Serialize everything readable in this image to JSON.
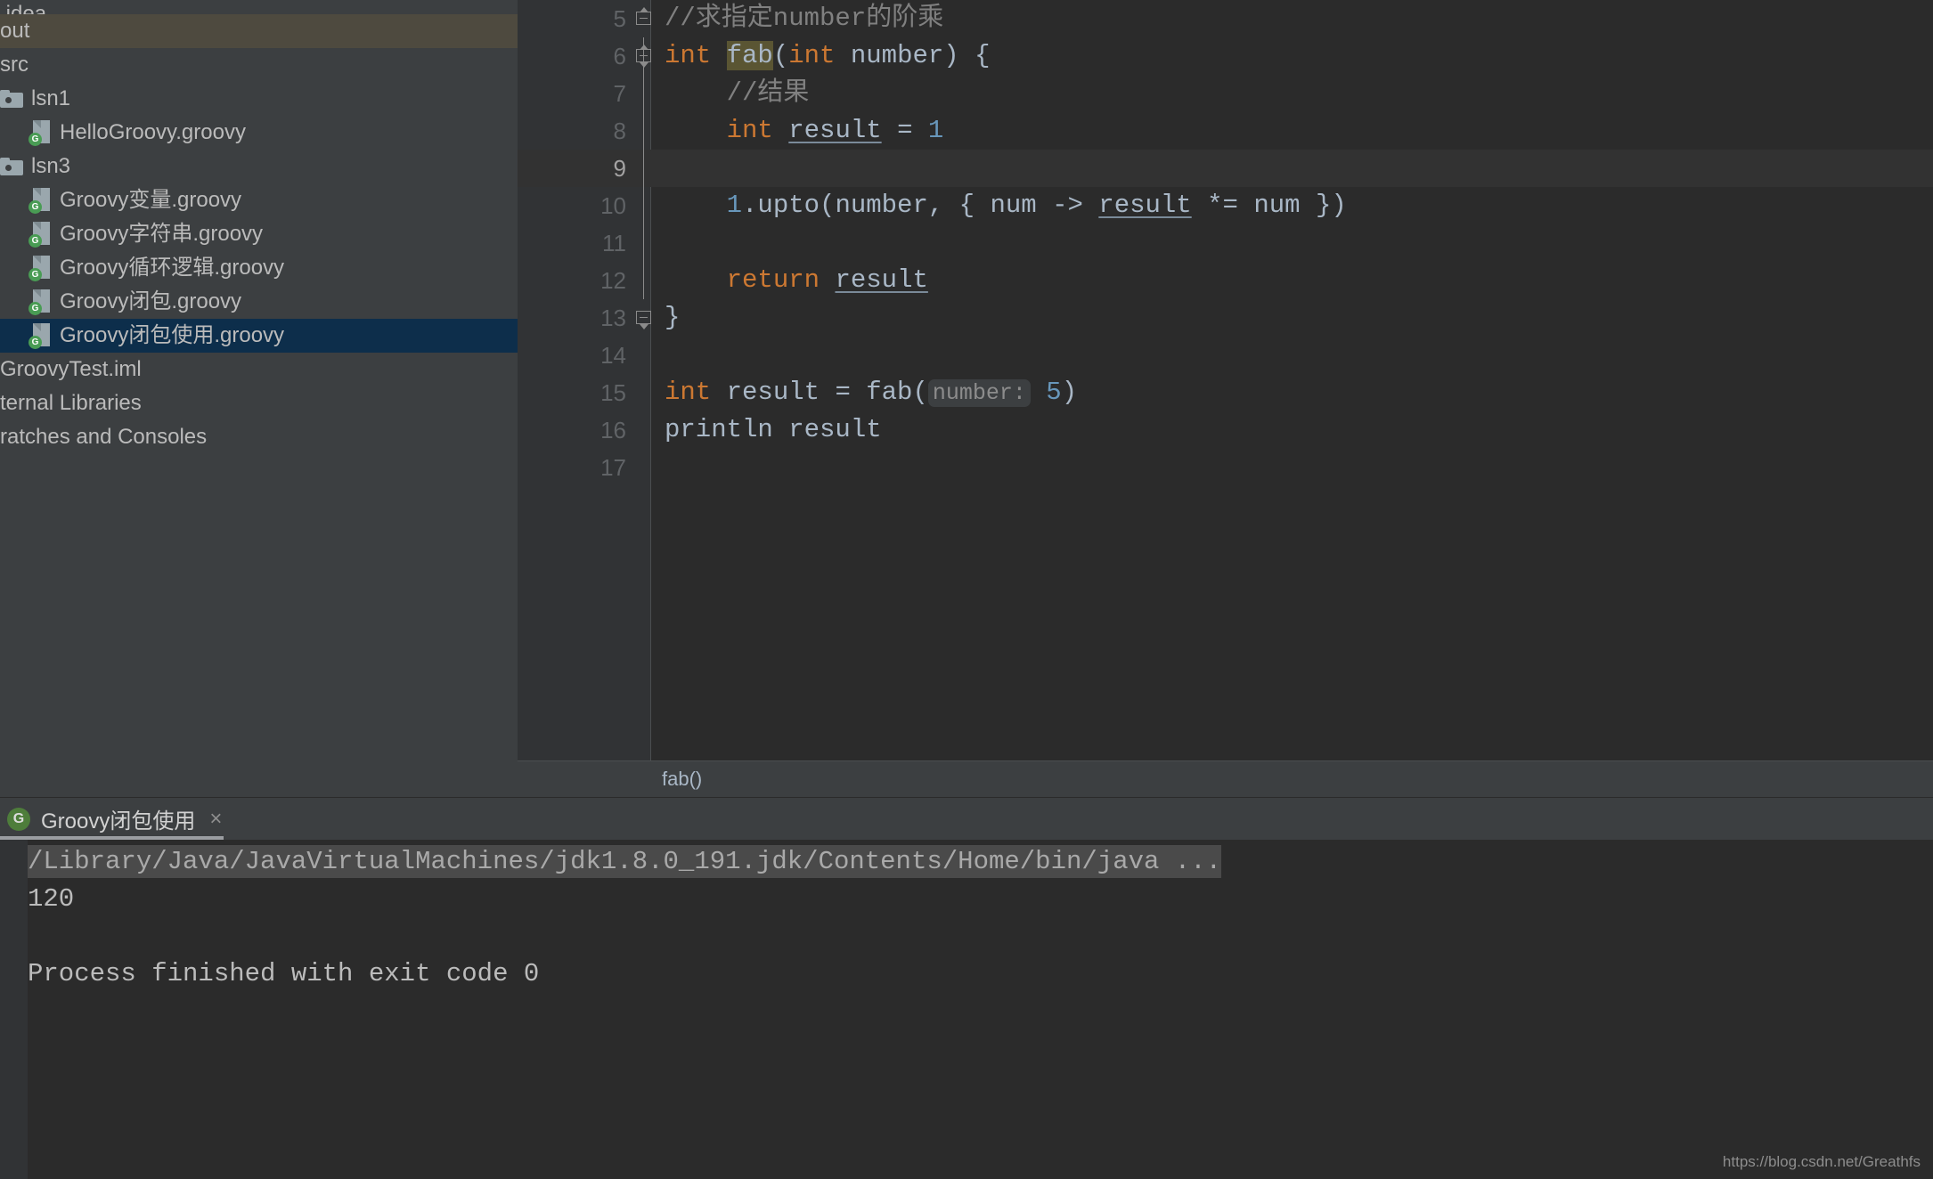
{
  "sidebar": {
    "items": [
      {
        "label": ".idea",
        "icon": "none",
        "indent": 0,
        "state": "partial-top"
      },
      {
        "label": "out",
        "icon": "none",
        "indent": 0,
        "state": "highlight-olive"
      },
      {
        "label": "src",
        "icon": "none",
        "indent": 0,
        "state": "normal"
      },
      {
        "label": "lsn1",
        "icon": "folder-icon",
        "indent": 1,
        "state": "normal"
      },
      {
        "label": "HelloGroovy.groovy",
        "icon": "groovy-file-icon",
        "indent": 2,
        "state": "normal"
      },
      {
        "label": "lsn3",
        "icon": "folder-icon",
        "indent": 1,
        "state": "normal"
      },
      {
        "label": "Groovy变量.groovy",
        "icon": "groovy-file-icon",
        "indent": 2,
        "state": "normal"
      },
      {
        "label": "Groovy字符串.groovy",
        "icon": "groovy-file-icon",
        "indent": 2,
        "state": "normal"
      },
      {
        "label": "Groovy循环逻辑.groovy",
        "icon": "groovy-file-icon",
        "indent": 2,
        "state": "normal"
      },
      {
        "label": "Groovy闭包.groovy",
        "icon": "groovy-file-icon",
        "indent": 2,
        "state": "normal"
      },
      {
        "label": "Groovy闭包使用.groovy",
        "icon": "groovy-file-icon",
        "indent": 2,
        "state": "selected"
      },
      {
        "label": "GroovyTest.iml",
        "icon": "none",
        "indent": 0,
        "state": "normal"
      },
      {
        "label": "ternal Libraries",
        "icon": "none",
        "indent": 0,
        "state": "normal"
      },
      {
        "label": "ratches and Consoles",
        "icon": "none",
        "indent": 0,
        "state": "normal"
      }
    ]
  },
  "editor": {
    "first_line_number": 5,
    "caret_line": 9,
    "lines": [
      {
        "num": "5",
        "caret": false,
        "fold": "start",
        "tokens": [
          {
            "t": "//求指定number的阶乘",
            "c": "cmt"
          }
        ]
      },
      {
        "num": "6",
        "caret": false,
        "fold": "mid-top",
        "tokens": [
          {
            "t": "int",
            "c": "kw"
          },
          {
            "t": " ",
            "c": "plain"
          },
          {
            "t": "fab",
            "c": "hl-ident"
          },
          {
            "t": "(",
            "c": "plain"
          },
          {
            "t": "int",
            "c": "kw"
          },
          {
            "t": " number) {",
            "c": "plain"
          }
        ]
      },
      {
        "num": "7",
        "caret": false,
        "fold": "line",
        "tokens": [
          {
            "t": "    ",
            "c": "plain"
          },
          {
            "t": "//结果",
            "c": "cmt"
          }
        ]
      },
      {
        "num": "8",
        "caret": false,
        "fold": "line",
        "tokens": [
          {
            "t": "    ",
            "c": "plain"
          },
          {
            "t": "int",
            "c": "kw"
          },
          {
            "t": " ",
            "c": "plain"
          },
          {
            "t": "result",
            "c": "fld"
          },
          {
            "t": " = ",
            "c": "plain"
          },
          {
            "t": "1",
            "c": "num"
          }
        ]
      },
      {
        "num": "9",
        "caret": true,
        "fold": "line",
        "tokens": []
      },
      {
        "num": "10",
        "caret": false,
        "fold": "line",
        "tokens": [
          {
            "t": "    ",
            "c": "plain"
          },
          {
            "t": "1",
            "c": "num"
          },
          {
            "t": ".upto(number, { num -> ",
            "c": "plain"
          },
          {
            "t": "result",
            "c": "fld"
          },
          {
            "t": " *= num })",
            "c": "plain"
          }
        ]
      },
      {
        "num": "11",
        "caret": false,
        "fold": "line",
        "tokens": []
      },
      {
        "num": "12",
        "caret": false,
        "fold": "line",
        "tokens": [
          {
            "t": "    ",
            "c": "plain"
          },
          {
            "t": "return",
            "c": "kw"
          },
          {
            "t": " ",
            "c": "plain"
          },
          {
            "t": "result",
            "c": "fld"
          }
        ]
      },
      {
        "num": "13",
        "caret": false,
        "fold": "end",
        "tokens": [
          {
            "t": "}",
            "c": "plain"
          }
        ]
      },
      {
        "num": "14",
        "caret": false,
        "fold": "none",
        "tokens": []
      },
      {
        "num": "15",
        "caret": false,
        "fold": "none",
        "tokens": [
          {
            "t": "int",
            "c": "kw"
          },
          {
            "t": " result = fab(",
            "c": "plain"
          },
          {
            "t": "number:",
            "c": "hint"
          },
          {
            "t": " ",
            "c": "plain"
          },
          {
            "t": "5",
            "c": "num"
          },
          {
            "t": ")",
            "c": "plain"
          }
        ]
      },
      {
        "num": "16",
        "caret": false,
        "fold": "none",
        "tokens": [
          {
            "t": "println result",
            "c": "plain"
          }
        ]
      },
      {
        "num": "17",
        "caret": false,
        "fold": "none",
        "tokens": []
      }
    ]
  },
  "breadcrumb": {
    "text": "fab()"
  },
  "run_window": {
    "tab": {
      "icon_letter": "G",
      "name": "Groovy闭包使用",
      "close_label": "×"
    },
    "console_lines": [
      {
        "text": "/Library/Java/JavaVirtualMachines/jdk1.8.0_191.jdk/Contents/Home/bin/java ...",
        "type": "command"
      },
      {
        "text": "120",
        "type": "output"
      },
      {
        "text": "",
        "type": "output"
      },
      {
        "text": "Process finished with exit code 0",
        "type": "output"
      }
    ]
  },
  "watermark": {
    "text": "https://blog.csdn.net/Greathfs"
  },
  "colors": {
    "editor_bg": "#2b2b2b",
    "panel_bg": "#3c3f41",
    "gutter_bg": "#313335",
    "selection_blue": "#0d2e4b",
    "highlight_olive": "#4e4a3f",
    "keyword_orange": "#cc7832",
    "number_blue": "#6897bb",
    "text_grey": "#a9b7c6",
    "comment_grey": "#808080",
    "groovy_green": "#499c54"
  }
}
